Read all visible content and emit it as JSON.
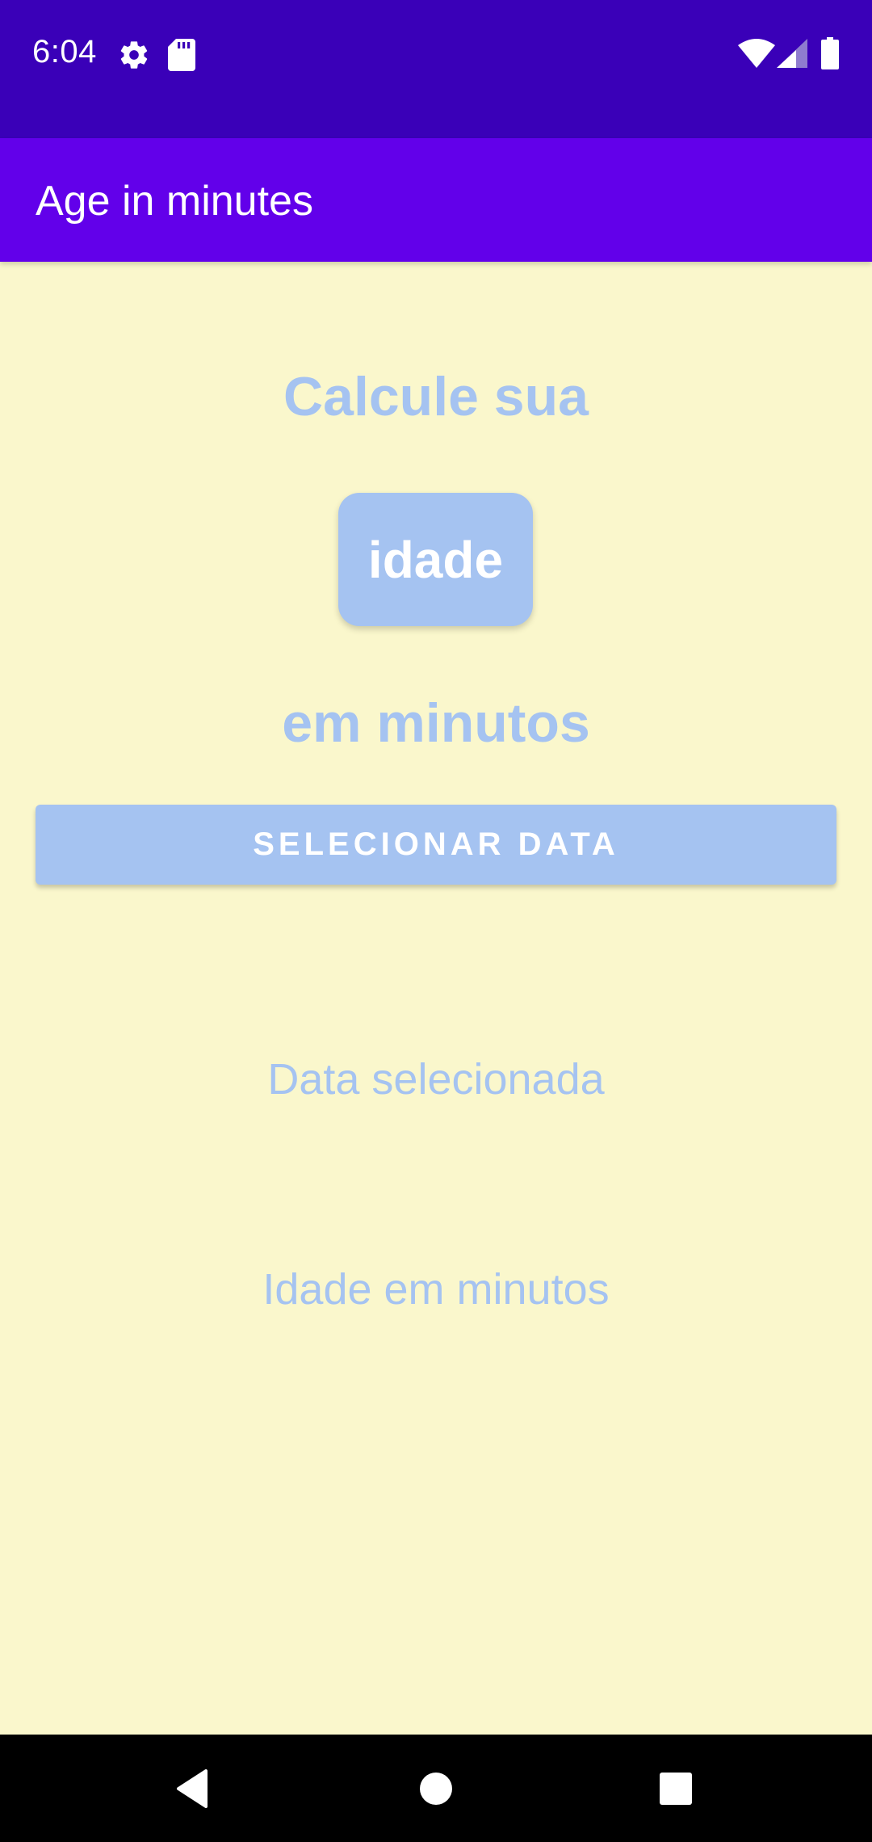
{
  "status_bar": {
    "time": "6:04",
    "icons": [
      "gear-icon",
      "sd-card-icon",
      "wifi-icon",
      "cell-signal-icon",
      "battery-icon"
    ]
  },
  "app_bar": {
    "title": "Age in minutes"
  },
  "main": {
    "heading_line1": "Calcule sua",
    "heading_box": "idade",
    "heading_line3": "em minutos",
    "select_button_label": "SELECIONAR DATA",
    "selected_date_text": "Data selecionada",
    "age_minutes_text": "Idade em minutos"
  },
  "nav_bar": {
    "icons": [
      "back-icon",
      "home-icon",
      "recents-icon"
    ]
  },
  "colors": {
    "status_bar": "#3a00b8",
    "app_bar": "#6200ea",
    "background": "#faf7cc",
    "accent": "#a5c3f1"
  }
}
